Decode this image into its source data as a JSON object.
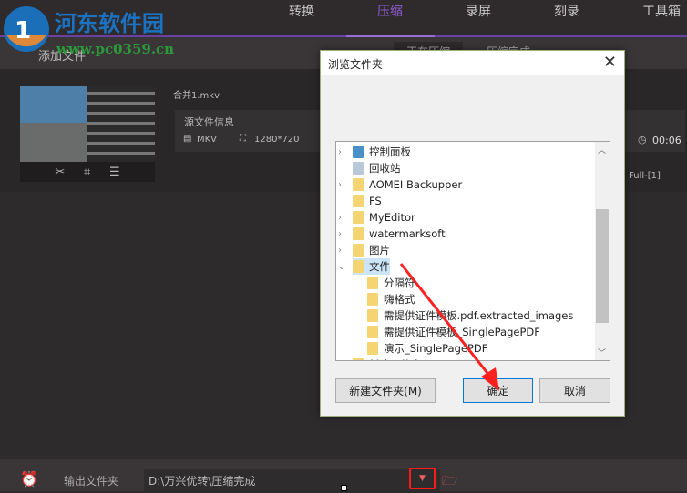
{
  "header": {
    "nav": [
      "转换",
      "压缩",
      "录屏",
      "刻录",
      "工具箱"
    ],
    "active": "压缩"
  },
  "watermark": {
    "name": "河东软件园",
    "url": "www.pc0359.cn"
  },
  "toolbar": {
    "add_file": "添加文件",
    "subtabs": [
      "正在压缩",
      "压缩完成"
    ]
  },
  "file": {
    "name": "合并1.mkv",
    "info_title": "源文件信息",
    "format": "MKV",
    "resolution": "1280*720",
    "duration": "00:06",
    "preset": "Full-[1]"
  },
  "dialog": {
    "title": "浏览文件夹",
    "close": "✕",
    "tree": [
      {
        "label": "控制面板",
        "indent": 0,
        "expand": ">"
      },
      {
        "label": "回收站",
        "indent": 0,
        "expand": ""
      },
      {
        "label": "AOMEI Backupper",
        "indent": 0,
        "expand": ">"
      },
      {
        "label": "FS",
        "indent": 0,
        "expand": ""
      },
      {
        "label": "MyEditor",
        "indent": 0,
        "expand": ">"
      },
      {
        "label": "watermarksoft",
        "indent": 0,
        "expand": ">"
      },
      {
        "label": "图片",
        "indent": 0,
        "expand": ">"
      },
      {
        "label": "文件",
        "indent": 0,
        "expand": "v",
        "selected": true
      },
      {
        "label": "分隔符",
        "indent": 1,
        "expand": ""
      },
      {
        "label": "嗨格式",
        "indent": 1,
        "expand": ""
      },
      {
        "label": "需提供证件模板.pdf.extracted_images",
        "indent": 1,
        "expand": ""
      },
      {
        "label": "需提供证件模板_SinglePagePDF",
        "indent": 1,
        "expand": ""
      },
      {
        "label": "演示_SinglePagePDF",
        "indent": 1,
        "expand": ""
      },
      {
        "label": "新建文件夹",
        "indent": 0,
        "expand": ""
      }
    ],
    "buttons": {
      "new_folder": "新建文件夹(M)",
      "ok": "确定",
      "cancel": "取消"
    }
  },
  "bottom": {
    "output_label": "输出文件夹",
    "output_path": "D:\\万兴优转\\压缩完成"
  },
  "colors": {
    "accent": "#8e5bd0",
    "annotation": "#ff1a1a"
  }
}
